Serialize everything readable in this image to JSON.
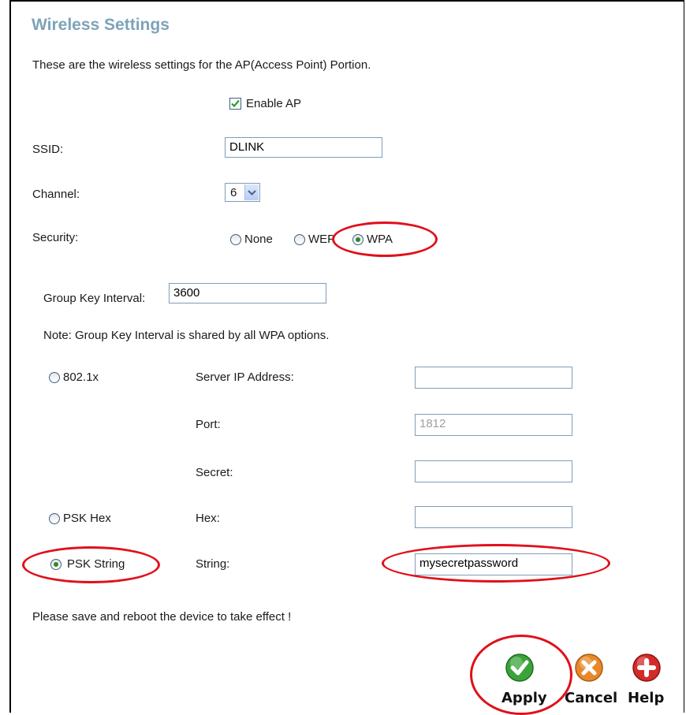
{
  "page": {
    "title": "Wireless Settings",
    "description": "These are the wireless settings for the AP(Access Point) Portion.",
    "footer_note": "Please save and reboot the device to take effect !"
  },
  "enable_ap": {
    "label": "Enable AP",
    "checked": true
  },
  "ssid": {
    "label": "SSID:",
    "value": "DLINK"
  },
  "channel": {
    "label": "Channel:",
    "value": "6"
  },
  "security": {
    "label": "Security:",
    "options": [
      {
        "label": "None",
        "selected": false
      },
      {
        "label": "WEP",
        "selected": false
      },
      {
        "label": "WPA",
        "selected": true
      }
    ]
  },
  "group_key": {
    "label": "Group Key Interval:",
    "value": "3600"
  },
  "wpa_note": "Note: Group Key Interval is shared by all WPA options.",
  "wpa_modes": {
    "dot1x": {
      "label": "802.1x",
      "selected": false,
      "server_label": "Server IP Address:",
      "server_value": "",
      "port_label": "Port:",
      "port_value": "1812",
      "secret_label": "Secret:",
      "secret_value": ""
    },
    "psk_hex": {
      "label": "PSK Hex",
      "selected": false,
      "hex_label": "Hex:",
      "hex_value": ""
    },
    "psk_string": {
      "label": "PSK String",
      "selected": true,
      "string_label": "String:",
      "string_value": "mysecretpassword"
    }
  },
  "buttons": {
    "apply": "Apply",
    "cancel": "Cancel",
    "help": "Help"
  },
  "colors": {
    "title": "#7da3b8",
    "annotation": "#e0101a",
    "apply": "#3aa33a",
    "cancel": "#e8882a",
    "help": "#d42a2a"
  }
}
